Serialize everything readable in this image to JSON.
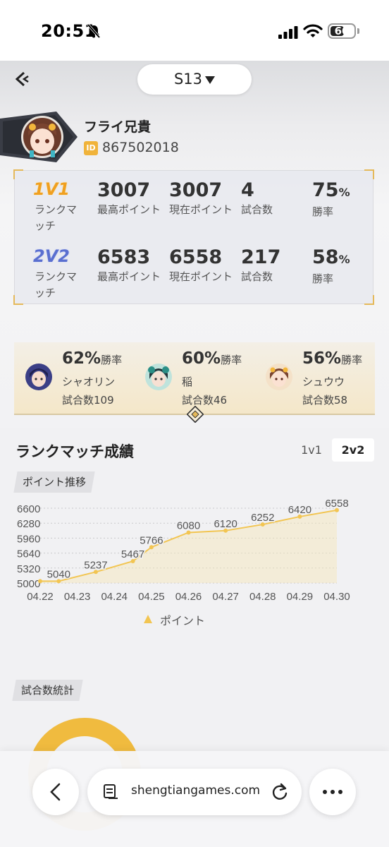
{
  "status_bar": {
    "time": "20:51",
    "battery": "60",
    "battery_level": 0.6,
    "icons": [
      "bell-slash-icon",
      "signal-icon",
      "wifi-icon",
      "battery-icon"
    ]
  },
  "header": {
    "season": "S13"
  },
  "profile": {
    "name": "フライ兄貴",
    "id_badge": "ID",
    "id": "867502018"
  },
  "ranked": [
    {
      "mode": "1V1",
      "mode_label": "ランクマッチ",
      "max_points": "3007",
      "max_points_label": "最高ポイント",
      "current_points": "3007",
      "current_points_label": "現在ポイント",
      "games": "4",
      "games_label": "試合数",
      "win_rate": "75",
      "win_rate_unit": "%",
      "win_rate_label": "勝率"
    },
    {
      "mode": "2V2",
      "mode_label": "ランクマッチ",
      "max_points": "6583",
      "max_points_label": "最高ポイント",
      "current_points": "6558",
      "current_points_label": "現在ポイント",
      "games": "217",
      "games_label": "試合数",
      "win_rate": "58",
      "win_rate_unit": "%",
      "win_rate_label": "勝率"
    }
  ],
  "characters": [
    {
      "rate": "62%",
      "rate_label": "勝率",
      "name": "シャオリン",
      "games": "試合数109"
    },
    {
      "rate": "60%",
      "rate_label": "勝率",
      "name": "稲",
      "games": "試合数46"
    },
    {
      "rate": "56%",
      "rate_label": "勝率",
      "name": "シュウウ",
      "games": "試合数58"
    }
  ],
  "rank_results": {
    "title": "ランクマッチ成績",
    "toggle_1v1": "1v1",
    "toggle_2v2": "2v2",
    "selected": "2v2",
    "points_tag": "ポイント推移",
    "legend": "ポイント",
    "stats_tag": "試合数統計"
  },
  "chart_data": {
    "type": "area",
    "x": [
      "04.22",
      "04.23",
      "04.24",
      "04.25",
      "04.26",
      "04.27",
      "04.28",
      "04.29",
      "04.30"
    ],
    "series": [
      {
        "name": "ポイント",
        "values": [
          5040,
          5040,
          5237,
          5467,
          5766,
          6080,
          6120,
          6252,
          6420,
          6558
        ]
      }
    ],
    "point_x": [
      0,
      0.5,
      1.5,
      2.5,
      3,
      4,
      5,
      6,
      7,
      8
    ],
    "point_labels": [
      "",
      "5040",
      "5237",
      "5467",
      "5766",
      "6080",
      "6120",
      "6252",
      "6420",
      "6558"
    ],
    "yticks": [
      5000,
      5320,
      5640,
      5960,
      6280,
      6600
    ],
    "ylim": [
      5000,
      6600
    ],
    "grid": true,
    "legend_position": "bottom",
    "color": "#f2c552"
  },
  "browser": {
    "url": "shengtiangames.com",
    "icons": [
      "back-arrow-icon",
      "reader-icon",
      "reload-icon",
      "more-icon"
    ]
  }
}
